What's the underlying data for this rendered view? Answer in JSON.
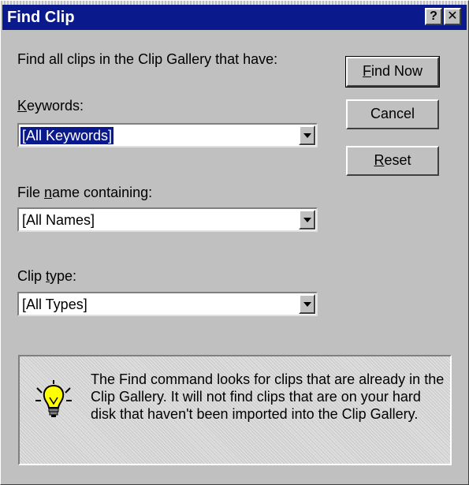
{
  "window": {
    "title": "Find Clip",
    "help_label": "?",
    "close_label": "✕"
  },
  "form": {
    "intro": "Find all clips in the Clip Gallery that have:",
    "keywords_label_mnemonic": "K",
    "keywords_label_rest": "eywords:",
    "keywords_value": "[All Keywords]",
    "filename_label_pre": "File ",
    "filename_label_mnemonic": "n",
    "filename_label_post": "ame containing:",
    "filename_value": "[All Names]",
    "cliptype_label_pre": "Clip ",
    "cliptype_label_mnemonic": "t",
    "cliptype_label_post": "ype:",
    "cliptype_value": "[All Types]"
  },
  "buttons": {
    "find_now_mnemonic": "F",
    "find_now_rest": "ind Now",
    "cancel": "Cancel",
    "reset_mnemonic": "R",
    "reset_rest": "eset"
  },
  "tip": {
    "icon": "lightbulb-icon",
    "text": "The Find command looks for clips that are already in the Clip Gallery.  It will not find clips that are on your hard disk that haven't been imported into the Clip Gallery."
  },
  "colors": {
    "titlebar": "#0a1a8c",
    "dialog_bg": "#c0c0c0",
    "bulb": "#ffff00"
  }
}
